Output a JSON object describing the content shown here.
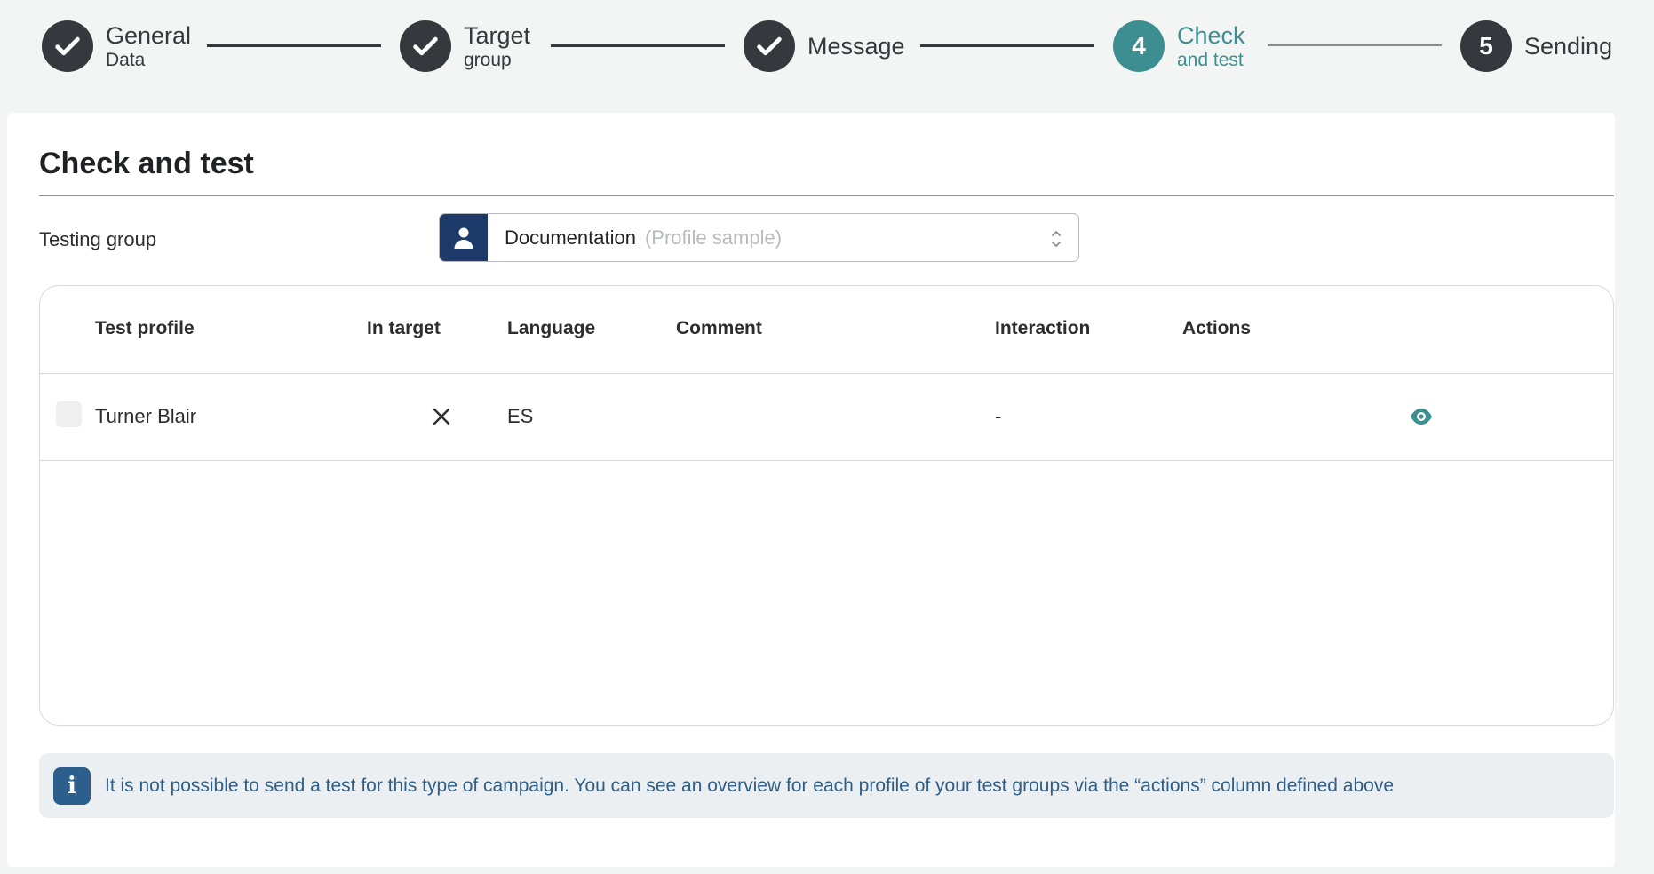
{
  "stepper": {
    "steps": [
      {
        "number": "",
        "title": "General",
        "sub": "Data",
        "state": "done"
      },
      {
        "number": "",
        "title": "Target",
        "sub": "group",
        "state": "done"
      },
      {
        "number": "",
        "title": "Message",
        "sub": "",
        "state": "done"
      },
      {
        "number": "4",
        "title": "Check",
        "sub": "and test",
        "state": "active"
      },
      {
        "number": "5",
        "title": "Sending",
        "sub": "",
        "state": "pending"
      }
    ]
  },
  "page": {
    "title": "Check and test"
  },
  "testing_group": {
    "label": "Testing group",
    "selected": "Documentation",
    "hint": "(Profile sample)",
    "icon": "user-icon"
  },
  "table": {
    "columns": [
      "Test profile",
      "In target",
      "Language",
      "Comment",
      "Interaction",
      "Actions"
    ],
    "rows": [
      {
        "profile": "Turner Blair",
        "in_target": "×",
        "language": "ES",
        "comment": "",
        "interaction": "-",
        "action_icon": "eye-icon"
      }
    ]
  },
  "info": {
    "icon": "i",
    "text": "It is not possible to send a test for this type of campaign. You can see an overview for each profile of your test groups via the “actions” column defined above"
  },
  "colors": {
    "accent": "#3d8e90",
    "dark": "#35393d",
    "select_icon_bg": "#1e3a6b",
    "info_bg": "#eceff2",
    "info_text": "#2f5e86"
  }
}
